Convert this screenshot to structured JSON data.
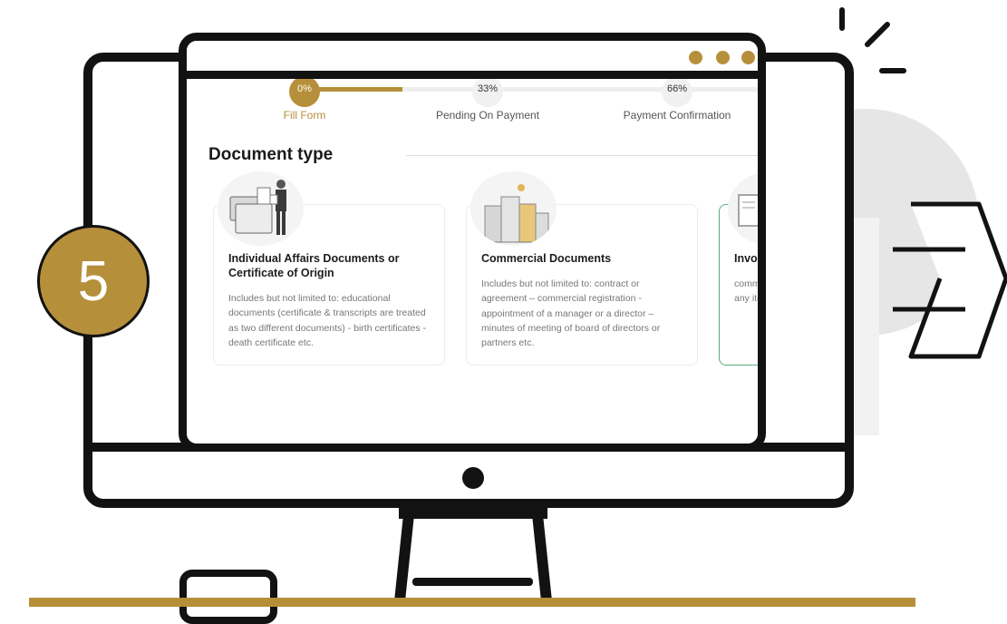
{
  "progress": {
    "percent": 0,
    "steps": [
      {
        "percent_label": "0%",
        "label": "Fill Form",
        "active": true
      },
      {
        "percent_label": "33%",
        "label": "Pending On Payment",
        "active": false
      },
      {
        "percent_label": "66%",
        "label": "Payment Confirmation",
        "active": false
      }
    ]
  },
  "section_title": "Document type",
  "cards": [
    {
      "title": "Individual Affairs Documents or Certificate of Origin",
      "description": "Includes but not limited to: educational documents (certificate & transcripts are treated as two different documents) - birth certificates - death certificate etc.",
      "icon": "person-with-documents-illustration"
    },
    {
      "title": "Commercial Documents",
      "description": "Includes but not limited to: contract or agreement – commercial registration - appointment of a manager or a director – minutes of meeting of board of directors or partners etc.",
      "icon": "buildings-illustration"
    },
    {
      "title": "Invoi",
      "description_line1": "comm",
      "description_line2": "any ite",
      "icon": "invoice-illustration"
    }
  ],
  "step_badge": "5",
  "accent_color": "#b68f3b"
}
